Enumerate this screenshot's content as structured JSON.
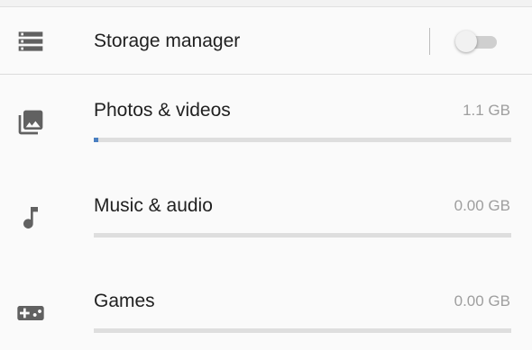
{
  "storage_manager": {
    "label": "Storage manager",
    "icon": "storage-icon",
    "toggle_on": false
  },
  "categories": [
    {
      "label": "Photos & videos",
      "size": "1.1 GB",
      "icon": "photo-library-icon",
      "fill_fraction": 0.01
    },
    {
      "label": "Music & audio",
      "size": "0.00 GB",
      "icon": "music-note-icon",
      "fill_fraction": 0
    },
    {
      "label": "Games",
      "size": "0.00 GB",
      "icon": "gamepad-icon",
      "fill_fraction": 0
    }
  ],
  "colors": {
    "accent": "#4a7fc1",
    "bar_track": "#dedede",
    "secondary_text": "#9e9e9e",
    "icon": "#616161"
  }
}
